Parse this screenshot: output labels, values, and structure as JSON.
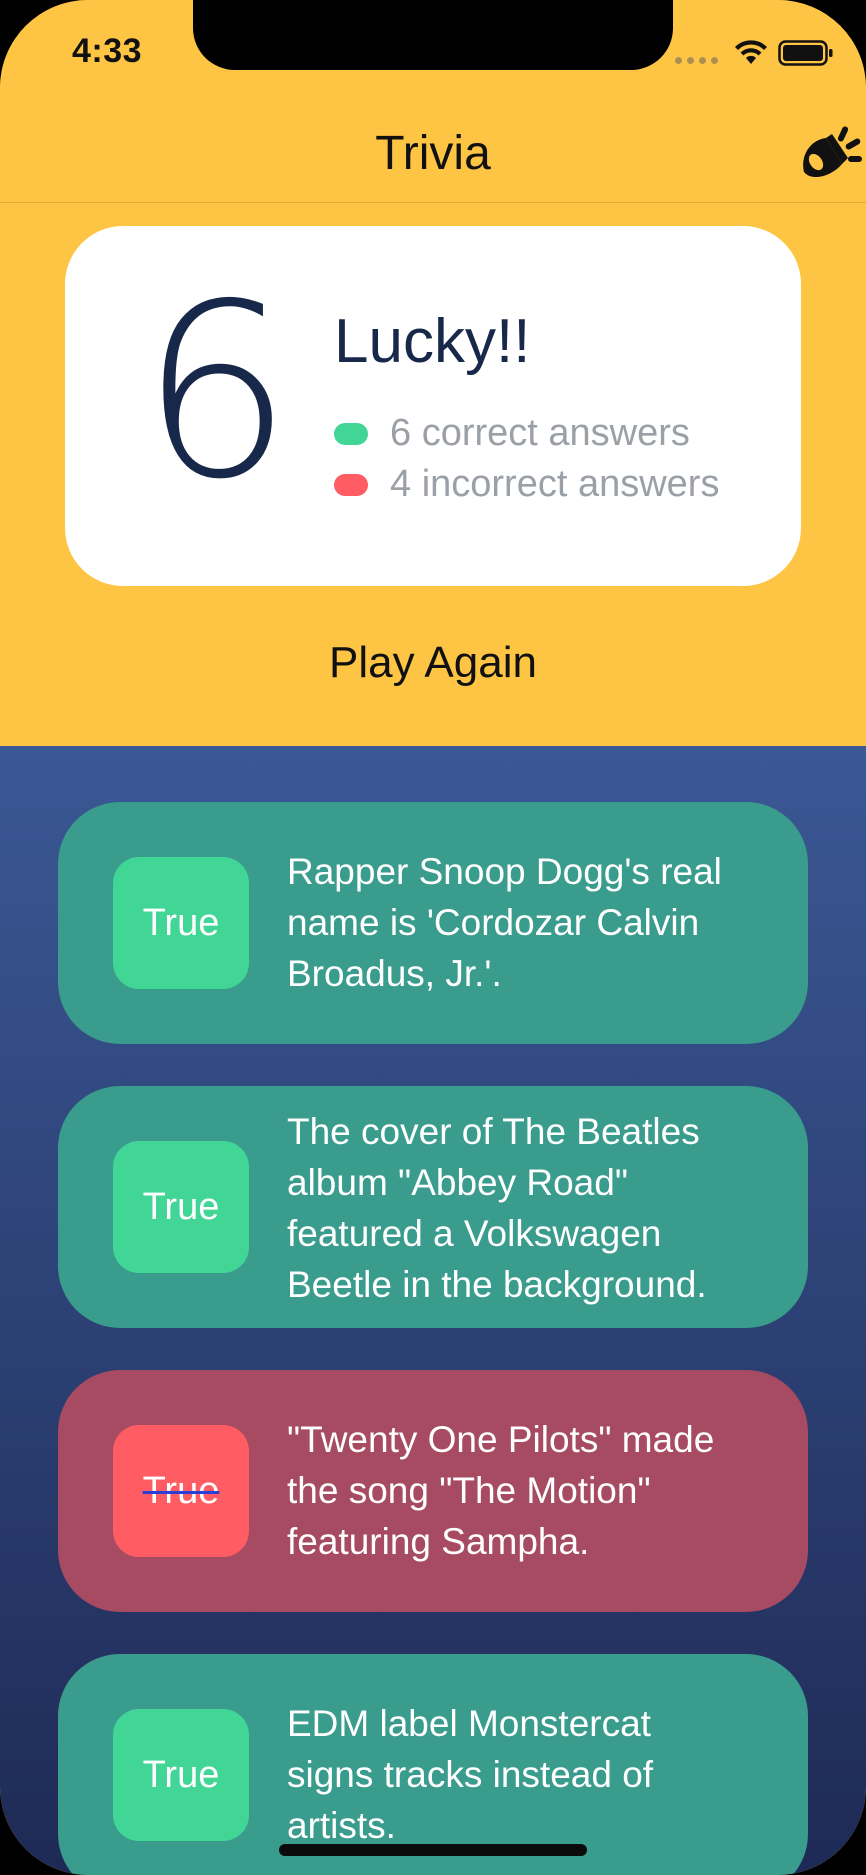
{
  "status_bar": {
    "time": "4:33"
  },
  "nav": {
    "title": "Trivia",
    "action_icon": "party-horn-icon"
  },
  "score": {
    "number": "6",
    "title": "Lucky!!",
    "correct_label": "6 correct answers",
    "incorrect_label": "4 incorrect answers"
  },
  "play_again_label": "Play Again",
  "questions": [
    {
      "answer": "True",
      "result": "correct",
      "text": "Rapper Snoop Dogg's real name is 'Cordozar Calvin Broadus, Jr.'."
    },
    {
      "answer": "True",
      "result": "correct",
      "text": "The cover of The Beatles album \"Abbey Road\" featured a Volkswagen Beetle in the background."
    },
    {
      "answer": "True",
      "result": "incorrect",
      "text": "\"Twenty One Pilots\" made the song \"The Motion\" featuring Sampha."
    },
    {
      "answer": "True",
      "result": "correct",
      "text": "EDM label Monstercat signs tracks instead of artists."
    }
  ],
  "colors": {
    "header_yellow": "#FEC443",
    "navy_text": "#17284A",
    "correct_green": "#41D695",
    "incorrect_red": "#FF5D63",
    "correct_card": "#3A9C8D",
    "incorrect_card": "#A74B62"
  }
}
